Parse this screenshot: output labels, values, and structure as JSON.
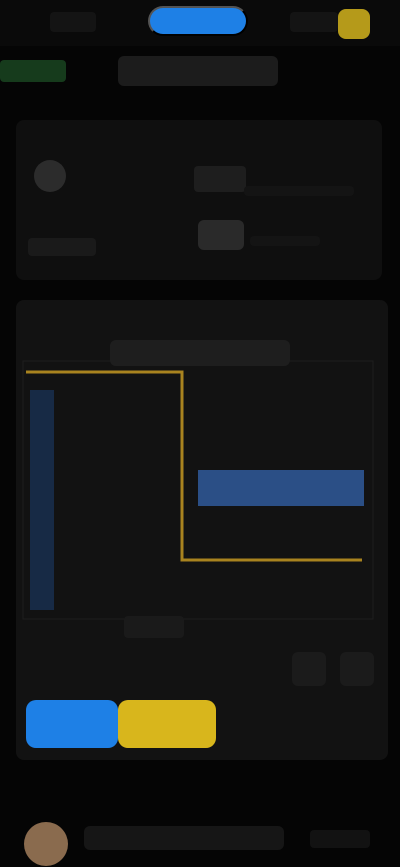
{
  "topbar": {
    "left_label": "",
    "center_button_label": "",
    "right_label": ""
  },
  "header": {
    "title": ""
  },
  "profile_card": {
    "label_a": "",
    "value_b": "",
    "value_c": ""
  },
  "chart_card": {
    "title": "",
    "footer_label": ""
  },
  "actions": {
    "primary_label": "",
    "secondary_label": ""
  },
  "footer": {
    "text": "",
    "side_label": ""
  },
  "colors": {
    "background": "#050505",
    "card": "#121212",
    "accent_blue": "#1e80e6",
    "accent_yellow": "#d8b61c",
    "avatar_gold": "#b59a1a",
    "status_green": "#163b1c",
    "chart_gold": "#a8831f",
    "chart_blue": "#2b4f86"
  },
  "icons": {
    "topbar_left": "menu-icon",
    "topbar_right": "settings-icon",
    "tool_one": "edit-icon",
    "tool_two": "more-icon"
  }
}
